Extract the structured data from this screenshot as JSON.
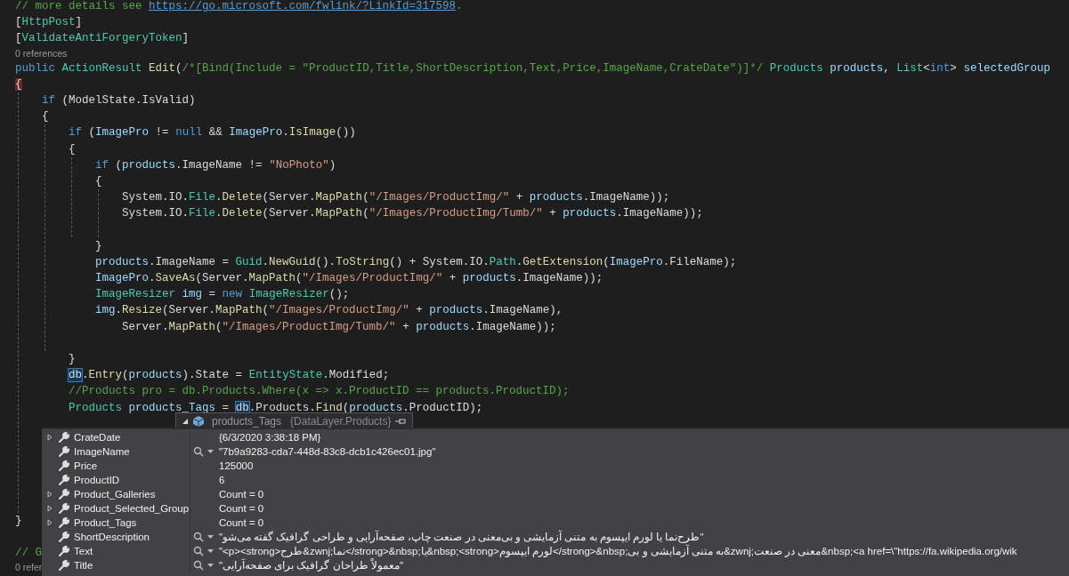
{
  "editor": {
    "lines": [
      {
        "kind": "code",
        "tokens": [
          {
            "kind": "comment",
            "text": "// more details see "
          },
          {
            "kind": "link",
            "text": "https://go.microsoft.com/fwlink/?LinkId=317598"
          },
          {
            "kind": "comment",
            "text": "."
          }
        ]
      },
      {
        "kind": "code",
        "tokens": [
          {
            "kind": "plain",
            "text": "["
          },
          {
            "kind": "type",
            "text": "HttpPost"
          },
          {
            "kind": "plain",
            "text": "]"
          }
        ]
      },
      {
        "kind": "code",
        "tokens": [
          {
            "kind": "plain",
            "text": "["
          },
          {
            "kind": "type",
            "text": "ValidateAntiForgeryToken"
          },
          {
            "kind": "plain",
            "text": "]"
          }
        ]
      },
      {
        "kind": "codelens",
        "text": "0 references"
      },
      {
        "kind": "code",
        "tokens": [
          {
            "kind": "keyword",
            "text": "public "
          },
          {
            "kind": "type",
            "text": "ActionResult "
          },
          {
            "kind": "method",
            "text": "Edit"
          },
          {
            "kind": "plain",
            "text": "("
          },
          {
            "kind": "comment",
            "text": "/*[Bind(Include = \"ProductID,Title,ShortDescription,Text,Price,ImageName,CrateDate\")]*/"
          },
          {
            "kind": "type",
            "text": " Products "
          },
          {
            "kind": "param",
            "text": "products"
          },
          {
            "kind": "plain",
            "text": ", "
          },
          {
            "kind": "type",
            "text": "List"
          },
          {
            "kind": "plain",
            "text": "<"
          },
          {
            "kind": "keyword",
            "text": "int"
          },
          {
            "kind": "plain",
            "text": "> "
          },
          {
            "kind": "param",
            "text": "selectedGroup"
          }
        ]
      },
      {
        "kind": "code",
        "tokens": [
          {
            "kind": "match",
            "text": "{"
          }
        ]
      },
      {
        "kind": "code",
        "tokens": [
          {
            "kind": "keyword",
            "text": "    if "
          },
          {
            "kind": "plain",
            "text": "(ModelState.IsValid)"
          }
        ]
      },
      {
        "kind": "code",
        "tokens": [
          {
            "kind": "plain",
            "text": "    {"
          }
        ]
      },
      {
        "kind": "code",
        "tokens": [
          {
            "kind": "keyword",
            "text": "        if "
          },
          {
            "kind": "plain",
            "text": "("
          },
          {
            "kind": "param",
            "text": "ImagePro"
          },
          {
            "kind": "plain",
            "text": " != "
          },
          {
            "kind": "keyword",
            "text": "null"
          },
          {
            "kind": "plain",
            "text": " && "
          },
          {
            "kind": "param",
            "text": "ImagePro"
          },
          {
            "kind": "plain",
            "text": "."
          },
          {
            "kind": "method",
            "text": "IsImage"
          },
          {
            "kind": "plain",
            "text": "())"
          }
        ]
      },
      {
        "kind": "code",
        "tokens": [
          {
            "kind": "plain",
            "text": "        {"
          }
        ]
      },
      {
        "kind": "code",
        "tokens": [
          {
            "kind": "keyword",
            "text": "            if "
          },
          {
            "kind": "plain",
            "text": "("
          },
          {
            "kind": "param",
            "text": "products"
          },
          {
            "kind": "plain",
            "text": ".ImageName != "
          },
          {
            "kind": "string",
            "text": "\"NoPhoto\""
          },
          {
            "kind": "plain",
            "text": ")"
          }
        ]
      },
      {
        "kind": "code",
        "tokens": [
          {
            "kind": "plain",
            "text": "            {"
          }
        ]
      },
      {
        "kind": "code",
        "tokens": [
          {
            "kind": "plain",
            "text": "                System.IO."
          },
          {
            "kind": "type",
            "text": "File"
          },
          {
            "kind": "plain",
            "text": "."
          },
          {
            "kind": "method",
            "text": "Delete"
          },
          {
            "kind": "plain",
            "text": "(Server."
          },
          {
            "kind": "method",
            "text": "MapPath"
          },
          {
            "kind": "plain",
            "text": "("
          },
          {
            "kind": "string",
            "text": "\"/Images/ProductImg/\""
          },
          {
            "kind": "plain",
            "text": " + "
          },
          {
            "kind": "param",
            "text": "products"
          },
          {
            "kind": "plain",
            "text": ".ImageName));"
          }
        ]
      },
      {
        "kind": "code",
        "tokens": [
          {
            "kind": "plain",
            "text": "                System.IO."
          },
          {
            "kind": "type",
            "text": "File"
          },
          {
            "kind": "plain",
            "text": "."
          },
          {
            "kind": "method",
            "text": "Delete"
          },
          {
            "kind": "plain",
            "text": "(Server."
          },
          {
            "kind": "method",
            "text": "MapPath"
          },
          {
            "kind": "plain",
            "text": "("
          },
          {
            "kind": "string",
            "text": "\"/Images/ProductImg/Tumb/\""
          },
          {
            "kind": "plain",
            "text": " + "
          },
          {
            "kind": "param",
            "text": "products"
          },
          {
            "kind": "plain",
            "text": ".ImageName));"
          }
        ]
      },
      {
        "kind": "blank"
      },
      {
        "kind": "code",
        "tokens": [
          {
            "kind": "plain",
            "text": "            }"
          }
        ]
      },
      {
        "kind": "code",
        "tokens": [
          {
            "kind": "param",
            "text": "            products"
          },
          {
            "kind": "plain",
            "text": ".ImageName = "
          },
          {
            "kind": "type",
            "text": "Guid"
          },
          {
            "kind": "plain",
            "text": "."
          },
          {
            "kind": "method",
            "text": "NewGuid"
          },
          {
            "kind": "plain",
            "text": "()."
          },
          {
            "kind": "method",
            "text": "ToString"
          },
          {
            "kind": "plain",
            "text": "() + System.IO."
          },
          {
            "kind": "type",
            "text": "Path"
          },
          {
            "kind": "plain",
            "text": "."
          },
          {
            "kind": "method",
            "text": "GetExtension"
          },
          {
            "kind": "plain",
            "text": "("
          },
          {
            "kind": "param",
            "text": "ImagePro"
          },
          {
            "kind": "plain",
            "text": ".FileName);"
          }
        ]
      },
      {
        "kind": "code",
        "tokens": [
          {
            "kind": "param",
            "text": "            ImagePro"
          },
          {
            "kind": "plain",
            "text": "."
          },
          {
            "kind": "method",
            "text": "SaveAs"
          },
          {
            "kind": "plain",
            "text": "(Server."
          },
          {
            "kind": "method",
            "text": "MapPath"
          },
          {
            "kind": "plain",
            "text": "("
          },
          {
            "kind": "string",
            "text": "\"/Images/ProductImg/\""
          },
          {
            "kind": "plain",
            "text": " + "
          },
          {
            "kind": "param",
            "text": "products"
          },
          {
            "kind": "plain",
            "text": ".ImageName));"
          }
        ]
      },
      {
        "kind": "code",
        "tokens": [
          {
            "kind": "type",
            "text": "            ImageResizer "
          },
          {
            "kind": "param",
            "text": "img"
          },
          {
            "kind": "plain",
            "text": " = "
          },
          {
            "kind": "keyword",
            "text": "new "
          },
          {
            "kind": "type",
            "text": "ImageResizer"
          },
          {
            "kind": "plain",
            "text": "();"
          }
        ]
      },
      {
        "kind": "code",
        "tokens": [
          {
            "kind": "param",
            "text": "            img"
          },
          {
            "kind": "plain",
            "text": "."
          },
          {
            "kind": "method",
            "text": "Resize"
          },
          {
            "kind": "plain",
            "text": "(Server."
          },
          {
            "kind": "method",
            "text": "MapPath"
          },
          {
            "kind": "plain",
            "text": "("
          },
          {
            "kind": "string",
            "text": "\"/Images/ProductImg/\""
          },
          {
            "kind": "plain",
            "text": " + "
          },
          {
            "kind": "param",
            "text": "products"
          },
          {
            "kind": "plain",
            "text": ".ImageName),"
          }
        ]
      },
      {
        "kind": "code",
        "tokens": [
          {
            "kind": "plain",
            "text": "                Server."
          },
          {
            "kind": "method",
            "text": "MapPath"
          },
          {
            "kind": "plain",
            "text": "("
          },
          {
            "kind": "string",
            "text": "\"/Images/ProductImg/Tumb/\""
          },
          {
            "kind": "plain",
            "text": " + "
          },
          {
            "kind": "param",
            "text": "products"
          },
          {
            "kind": "plain",
            "text": ".ImageName));"
          }
        ]
      },
      {
        "kind": "blank"
      },
      {
        "kind": "code",
        "tokens": [
          {
            "kind": "plain",
            "text": "        }"
          }
        ]
      },
      {
        "kind": "code",
        "tokens": [
          {
            "kind": "ref",
            "text": "        db"
          },
          {
            "kind": "plain",
            "text": "."
          },
          {
            "kind": "method",
            "text": "Entry"
          },
          {
            "kind": "plain",
            "text": "("
          },
          {
            "kind": "param",
            "text": "products"
          },
          {
            "kind": "plain",
            "text": ").State = "
          },
          {
            "kind": "type",
            "text": "EntityState"
          },
          {
            "kind": "plain",
            "text": ".Modified;"
          }
        ]
      },
      {
        "kind": "code",
        "tokens": [
          {
            "kind": "comment",
            "text": "        //Products pro = db.Products.Where(x => x.ProductID == products.ProductID);"
          }
        ]
      },
      {
        "kind": "code",
        "tokens": [
          {
            "kind": "type",
            "text": "        Products "
          },
          {
            "kind": "param",
            "text": "products_Tags"
          },
          {
            "kind": "plain",
            "text": " = "
          },
          {
            "kind": "ref",
            "text": "db"
          },
          {
            "kind": "plain",
            "text": ".Products."
          },
          {
            "kind": "method",
            "text": "Find"
          },
          {
            "kind": "plain",
            "text": "("
          },
          {
            "kind": "param",
            "text": "products"
          },
          {
            "kind": "plain",
            "text": ".ProductID);"
          }
        ]
      },
      {
        "kind": "blank"
      },
      {
        "kind": "blank"
      },
      {
        "kind": "blank"
      },
      {
        "kind": "blank"
      },
      {
        "kind": "blank"
      },
      {
        "kind": "blank"
      },
      {
        "kind": "code",
        "tokens": [
          {
            "kind": "plain",
            "text": "}"
          }
        ]
      },
      {
        "kind": "blank"
      },
      {
        "kind": "code",
        "tokens": [
          {
            "kind": "comment",
            "text": "// G"
          }
        ]
      },
      {
        "kind": "codelens",
        "text": "0 refer"
      }
    ]
  },
  "datatip": {
    "header": {
      "expanded": true,
      "name": "products_Tags",
      "type": "{DataLayer.Products}"
    },
    "rows": [
      {
        "name": "CrateDate",
        "value": "{6/3/2020 3:38:18 PM}",
        "expandable": true,
        "visualizer": false
      },
      {
        "name": "ImageName",
        "value": "\"7b9a9283-cda7-448d-83c8-dcb1c426ec01.jpg\"",
        "expandable": false,
        "visualizer": true
      },
      {
        "name": "Price",
        "value": "125000",
        "expandable": false,
        "visualizer": false
      },
      {
        "name": "ProductID",
        "value": "6",
        "expandable": false,
        "visualizer": false
      },
      {
        "name": "Product_Galleries",
        "value": "Count = 0",
        "expandable": true,
        "visualizer": false
      },
      {
        "name": "Product_Selected_Group",
        "value": "Count = 0",
        "expandable": true,
        "visualizer": false
      },
      {
        "name": "Product_Tags",
        "value": "Count = 0",
        "expandable": true,
        "visualizer": false
      },
      {
        "name": "ShortDescription",
        "value": "\"طرح‌نما یا لورم ایپسوم به متنی آزمایشی و بی‌معنی در صنعت چاپ، صفحه‌آرایی و طراحی گرافیک گفته می‌شو\"",
        "expandable": false,
        "visualizer": true
      },
      {
        "name": "Text",
        "value": "\"<p><strong>طرح&zwnj;نما</strong>&nbsp;یا&nbsp;<strong>لورم ایپسوم</strong>&nbsp;به متنی آزمایشی و بی&zwnj;معنی در صنعت&nbsp;<a href=\\\"https://fa.wikipedia.org/wik",
        "expandable": false,
        "visualizer": true
      },
      {
        "name": "Title",
        "value": "\"معمولاً طراحان گرافیک برای صفحه‌آرایی\"",
        "expandable": false,
        "visualizer": true
      }
    ]
  }
}
